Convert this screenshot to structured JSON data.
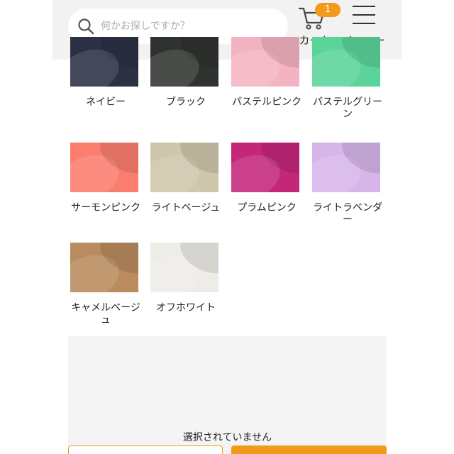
{
  "header": {
    "search": {
      "placeholder": "何かお探しですか？",
      "icon": "search-icon"
    },
    "cart": {
      "label": "カート",
      "badge": "1",
      "icon": "cart-icon"
    },
    "menu": {
      "label": "メニュー",
      "icon": "hamburger-menu-icon"
    }
  },
  "colors": {
    "accent": "#f39a1a",
    "header_bg": "#f2f2f2"
  },
  "variants": [
    {
      "label": "ネイビー",
      "color": "#2b3044"
    },
    {
      "label": "ブラック",
      "color": "#2f332f"
    },
    {
      "label": "パステルピンク",
      "color": "#f4b3c2"
    },
    {
      "label": "パステルグリーン",
      "color": "#5bd49a"
    },
    {
      "label": "サーモンピンク",
      "color": "#fb7d6e"
    },
    {
      "label": "ライトベージュ",
      "color": "#cfc6ac"
    },
    {
      "label": "プラムピンク",
      "color": "#c4267a"
    },
    {
      "label": "ライトラベンダー",
      "color": "#d6b5ea"
    },
    {
      "label": "キャメルベージュ",
      "color": "#b98b5e"
    },
    {
      "label": "オフホワイト",
      "color": "#eeece7"
    }
  ],
  "selection": {
    "status": "選択されていません"
  }
}
